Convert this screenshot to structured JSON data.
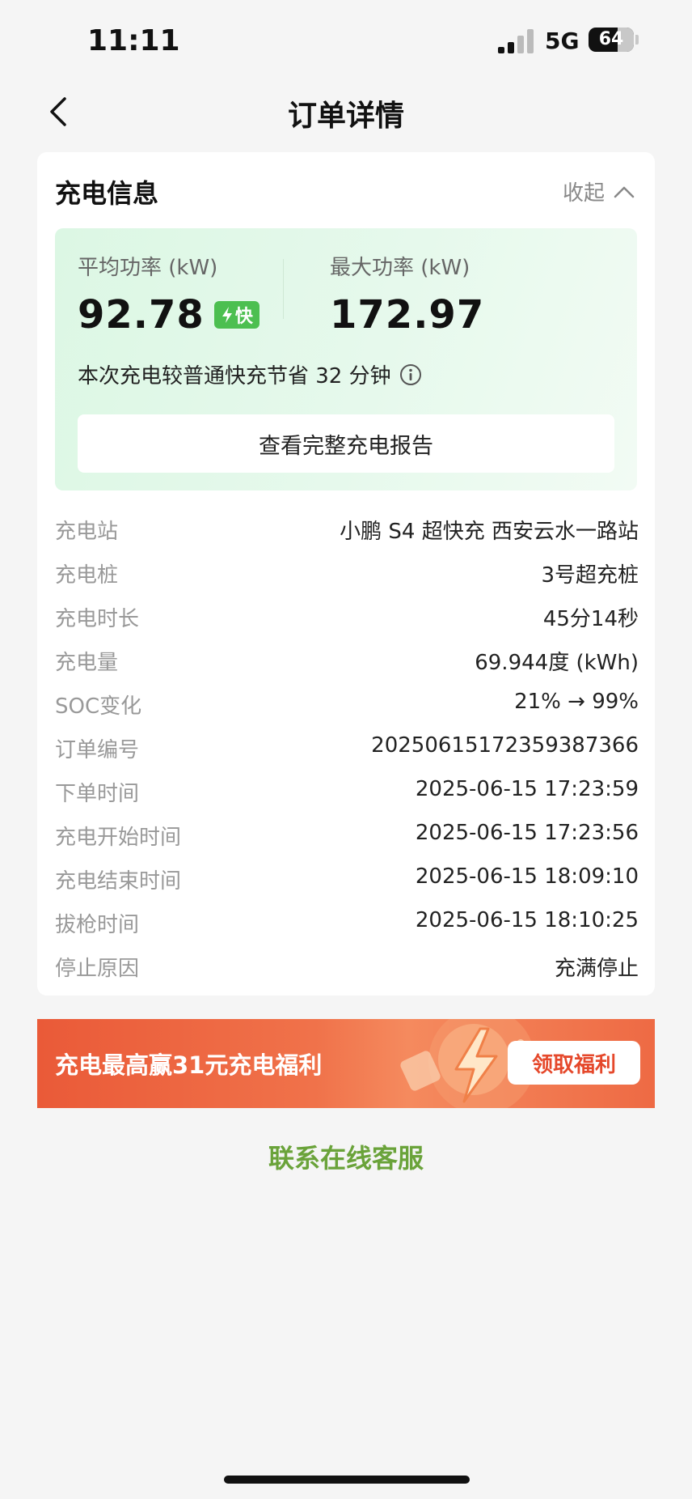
{
  "status_bar": {
    "time": "11:11",
    "network": "5G",
    "battery": "64"
  },
  "nav": {
    "title": "订单详情"
  },
  "charging_info": {
    "section_title": "充电信息",
    "collapse_label": "收起",
    "avg_power_label": "平均功率 (kW)",
    "avg_power_value": "92.78",
    "fast_badge": "快",
    "max_power_label": "最大功率 (kW)",
    "max_power_value": "172.97",
    "savings_text": "本次充电较普通快充节省 32 分钟",
    "report_button": "查看完整充电报告"
  },
  "details": [
    {
      "label": "充电站",
      "value": "小鹏 S4 超快充 西安云水一路站"
    },
    {
      "label": "充电桩",
      "value": "3号超充桩"
    },
    {
      "label": "充电时长",
      "value": "45分14秒"
    },
    {
      "label": "充电量",
      "value": "69.944度 (kWh)"
    },
    {
      "label": "SOC变化",
      "value": "21% → 99%"
    },
    {
      "label": "订单编号",
      "value": "20250615172359387366"
    },
    {
      "label": "下单时间",
      "value": "2025-06-15 17:23:59"
    },
    {
      "label": "充电开始时间",
      "value": "2025-06-15 17:23:56"
    },
    {
      "label": "充电结束时间",
      "value": "2025-06-15 18:09:10"
    },
    {
      "label": "拔枪时间",
      "value": "2025-06-15 18:10:25"
    },
    {
      "label": "停止原因",
      "value": "充满停止"
    }
  ],
  "promo": {
    "text": "充电最高赢31元充电福利",
    "button": "领取福利"
  },
  "service_link": "联系在线客服",
  "colors": {
    "brand_green": "#6aa33a",
    "badge_green": "#4cbf50",
    "promo_orange": "#ea5a38"
  },
  "icons": [
    "back-chevron-icon",
    "chevron-up-icon",
    "lightning-icon",
    "info-icon"
  ]
}
